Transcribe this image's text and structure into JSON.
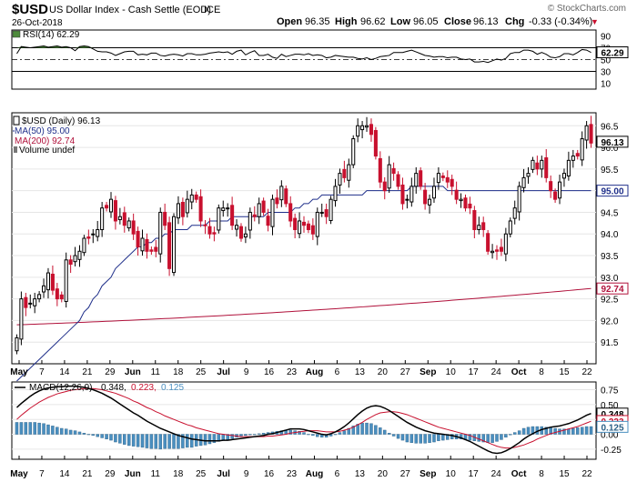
{
  "header": {
    "symbol": "$USD",
    "name": "US Dollar Index - Cash Settle (EOD)",
    "exchange": "ICE",
    "date": "26-Oct-2018",
    "watermark": "© StockCharts.com",
    "quote": {
      "open_label": "Open",
      "open": "96.35",
      "high_label": "High",
      "high": "96.62",
      "low_label": "Low",
      "low": "96.05",
      "close_label": "Close",
      "close": "96.13",
      "chg_label": "Chg",
      "chg": "-0.33 (-0.34%)",
      "chg_arrow": "▼"
    }
  },
  "colors": {
    "up": "#000000",
    "down": "#c8102e",
    "ma50": "#1f2f8a",
    "ma200": "#b0103a",
    "rsi_fill": "#4e8a3c",
    "macd_hist": "#4a8fc0",
    "signal": "#c8102e"
  },
  "chart_data": [
    {
      "type": "line",
      "panel": "rsi",
      "legend": "RSI(14) 62.29",
      "current_label": "62.29",
      "yticks": [
        "90",
        "70",
        "50",
        "30",
        "10"
      ],
      "ylim": [
        0,
        100
      ],
      "overbought": 70,
      "oversold": 30,
      "values": [
        60,
        72,
        71,
        70,
        71,
        72,
        73,
        71,
        72,
        73,
        71,
        72,
        70,
        65,
        72,
        73,
        72,
        68,
        64,
        63,
        63,
        61,
        57,
        60,
        63,
        64,
        64,
        58,
        59,
        58,
        61,
        61,
        57,
        56,
        58,
        59,
        58,
        56,
        60,
        60,
        58,
        58,
        59,
        61,
        62,
        63,
        62,
        63,
        59,
        64,
        66,
        58,
        62,
        65,
        57,
        57,
        59,
        54,
        52,
        59,
        55,
        57,
        59,
        59,
        58,
        60,
        57,
        58,
        57,
        53,
        54,
        57,
        56,
        55,
        54,
        54,
        52,
        51,
        53,
        50,
        52,
        55,
        56,
        57,
        62,
        62,
        62,
        64,
        66,
        63,
        60,
        57,
        56,
        54,
        55,
        55,
        53,
        54,
        54,
        51,
        50,
        51,
        46,
        46,
        47,
        45,
        48,
        51,
        49,
        52,
        60,
        62,
        62,
        66,
        66,
        64,
        59,
        62,
        59,
        54,
        53,
        55,
        60,
        60,
        58,
        62,
        67,
        66,
        62
      ]
    },
    {
      "type": "candlestick",
      "panel": "price",
      "legend": "$USD (Daily) 96.13",
      "ma50_legend": "MA(50) 95.00",
      "ma200_legend": "MA(200) 92.74",
      "volume_legend": "Volume undef",
      "price_label": "96.13",
      "ma50_label": "95.00",
      "ma200_label": "92.74",
      "yticks": [
        "96.5",
        "96.0",
        "95.5",
        "95.0",
        "94.5",
        "94.0",
        "93.5",
        "93.0",
        "92.5",
        "92.0",
        "91.5"
      ],
      "ylim": [
        91.0,
        96.8
      ],
      "x_labels": [
        "May",
        "7",
        "14",
        "21",
        "29",
        "Jun",
        "11",
        "18",
        "25",
        "Jul",
        "9",
        "16",
        "23",
        "Aug",
        "6",
        "13",
        "20",
        "27",
        "Sep",
        "10",
        "17",
        "24",
        "Oct",
        "8",
        "15",
        "22"
      ],
      "close": [
        91.6,
        92.5,
        92.3,
        92.4,
        92.5,
        92.6,
        92.8,
        93.1,
        92.7,
        92.5,
        92.5,
        93.4,
        93.3,
        93.5,
        93.6,
        93.9,
        93.9,
        94.0,
        94.1,
        94.6,
        94.6,
        94.8,
        94.3,
        94.4,
        94.2,
        94.3,
        94.0,
        93.7,
        93.9,
        93.6,
        93.6,
        93.6,
        94.5,
        94.2,
        93.2,
        94.4,
        94.7,
        94.4,
        94.8,
        94.9,
        94.8,
        94.3,
        94.2,
        94.0,
        94.0,
        94.6,
        94.6,
        94.6,
        94.2,
        94.2,
        93.9,
        94.0,
        94.5,
        94.4,
        94.7,
        94.5,
        94.2,
        94.8,
        94.7,
        95.1,
        94.7,
        94.3,
        94.1,
        94.3,
        94.2,
        94.1,
        94.0,
        94.5,
        94.5,
        94.4,
        94.8,
        95.1,
        95.4,
        95.3,
        95.6,
        96.2,
        96.5,
        96.5,
        96.5,
        96.3,
        95.8,
        95.2,
        95.0,
        95.6,
        95.4,
        95.1,
        94.7,
        94.8,
        95.1,
        95.4,
        95.1,
        94.7,
        94.8,
        95.1,
        95.4,
        95.3,
        95.2,
        95.1,
        94.8,
        94.8,
        94.6,
        94.6,
        94.1,
        94.2,
        94.1,
        93.6,
        93.6,
        93.6,
        93.6,
        94.0,
        94.3,
        94.6,
        95.1,
        95.3,
        95.4,
        95.7,
        95.5,
        95.7,
        95.3,
        95.0,
        94.8,
        95.2,
        95.4,
        95.7,
        95.8,
        95.8,
        96.2,
        96.5,
        96.1
      ],
      "ma50": [
        90.6,
        90.7,
        90.8,
        90.9,
        91.0,
        91.1,
        91.2,
        91.3,
        91.4,
        91.5,
        91.6,
        91.7,
        91.8,
        91.9,
        92.0,
        92.2,
        92.3,
        92.5,
        92.6,
        92.8,
        92.9,
        93.0,
        93.2,
        93.3,
        93.4,
        93.5,
        93.6,
        93.7,
        93.7,
        93.8,
        93.8,
        93.9,
        93.9,
        94.0,
        94.0,
        94.1,
        94.1,
        94.1,
        94.1,
        94.2,
        94.2,
        94.2,
        94.2,
        94.3,
        94.3,
        94.3,
        94.3,
        94.3,
        94.4,
        94.4,
        94.4,
        94.4,
        94.4,
        94.4,
        94.4,
        94.4,
        94.5,
        94.5,
        94.5,
        94.5,
        94.5,
        94.5,
        94.6,
        94.6,
        94.7,
        94.7,
        94.8,
        94.8,
        94.9,
        94.9,
        94.9,
        94.9,
        94.9,
        94.9,
        94.9,
        94.9,
        94.9,
        94.9,
        95.0,
        95.0,
        95.0,
        95.0,
        95.0,
        95.0,
        95.0,
        95.0,
        95.0,
        95.0,
        95.1,
        95.1,
        95.1,
        95.1,
        95.1,
        95.1,
        95.1,
        95.1,
        95.0,
        95.0,
        95.0,
        95.0,
        95.0,
        95.0,
        95.0,
        95.0,
        95.0,
        95.0,
        95.0,
        95.0,
        95.0,
        95.0,
        95.0,
        95.0,
        95.0,
        95.0,
        95.0,
        95.0,
        95.0,
        95.0,
        95.0,
        95.0,
        95.0,
        95.0,
        95.0,
        95.0,
        95.0,
        95.0,
        95.0,
        95.0,
        95.0
      ],
      "ma200_range": [
        91.9,
        92.74
      ]
    },
    {
      "type": "macd",
      "panel": "macd",
      "legend_prefix": "MACD(12,26,9)",
      "legend_macd": "0.348,",
      "legend_signal": "0.223,",
      "legend_hist": "0.125",
      "macd_label": "0.348",
      "signal_label": "0.223",
      "hist_label": "0.125",
      "yticks": [
        "0.75",
        "0.50",
        "0.25",
        "0.00",
        "-0.25"
      ],
      "ylim": [
        -0.42,
        0.88
      ],
      "x_labels": [
        "May",
        "7",
        "14",
        "21",
        "29",
        "Jun",
        "11",
        "18",
        "25",
        "Jul",
        "9",
        "16",
        "23",
        "Aug",
        "6",
        "13",
        "20",
        "27",
        "Sep",
        "10",
        "17",
        "24",
        "Oct",
        "8",
        "15",
        "22"
      ],
      "macd": [
        0.45,
        0.52,
        0.58,
        0.64,
        0.69,
        0.73,
        0.76,
        0.78,
        0.79,
        0.8,
        0.8,
        0.81,
        0.81,
        0.81,
        0.8,
        0.79,
        0.77,
        0.75,
        0.72,
        0.69,
        0.65,
        0.61,
        0.56,
        0.51,
        0.46,
        0.41,
        0.36,
        0.32,
        0.27,
        0.22,
        0.18,
        0.14,
        0.1,
        0.07,
        0.04,
        0.01,
        -0.02,
        -0.04,
        -0.06,
        -0.08,
        -0.09,
        -0.1,
        -0.11,
        -0.11,
        -0.11,
        -0.11,
        -0.1,
        -0.1,
        -0.09,
        -0.08,
        -0.07,
        -0.06,
        -0.05,
        -0.04,
        -0.03,
        -0.02,
        0.0,
        0.01,
        0.03,
        0.05,
        0.07,
        0.09,
        0.09,
        0.09,
        0.08,
        0.06,
        0.04,
        0.02,
        0.0,
        -0.01,
        0.01,
        0.04,
        0.08,
        0.13,
        0.19,
        0.26,
        0.33,
        0.39,
        0.44,
        0.47,
        0.48,
        0.47,
        0.44,
        0.4,
        0.35,
        0.3,
        0.25,
        0.2,
        0.16,
        0.12,
        0.09,
        0.06,
        0.04,
        0.02,
        0.01,
        0.0,
        -0.01,
        -0.02,
        -0.04,
        -0.06,
        -0.09,
        -0.12,
        -0.16,
        -0.2,
        -0.24,
        -0.28,
        -0.31,
        -0.32,
        -0.31,
        -0.28,
        -0.24,
        -0.19,
        -0.14,
        -0.08,
        -0.03,
        0.01,
        0.05,
        0.08,
        0.1,
        0.12,
        0.13,
        0.14,
        0.16,
        0.18,
        0.21,
        0.24,
        0.28,
        0.32,
        0.35
      ],
      "signal": [
        0.25,
        0.32,
        0.38,
        0.44,
        0.49,
        0.54,
        0.58,
        0.62,
        0.65,
        0.68,
        0.7,
        0.72,
        0.74,
        0.75,
        0.76,
        0.77,
        0.77,
        0.77,
        0.76,
        0.75,
        0.73,
        0.71,
        0.69,
        0.66,
        0.63,
        0.6,
        0.56,
        0.53,
        0.49,
        0.45,
        0.42,
        0.38,
        0.35,
        0.31,
        0.28,
        0.25,
        0.22,
        0.19,
        0.16,
        0.14,
        0.11,
        0.09,
        0.07,
        0.05,
        0.03,
        0.01,
        0.0,
        -0.01,
        -0.02,
        -0.03,
        -0.04,
        -0.04,
        -0.04,
        -0.04,
        -0.04,
        -0.04,
        -0.03,
        -0.03,
        -0.02,
        -0.01,
        0.0,
        0.02,
        0.03,
        0.04,
        0.05,
        0.06,
        0.06,
        0.06,
        0.05,
        0.04,
        0.04,
        0.04,
        0.05,
        0.07,
        0.09,
        0.12,
        0.16,
        0.2,
        0.25,
        0.29,
        0.33,
        0.36,
        0.37,
        0.38,
        0.38,
        0.37,
        0.35,
        0.33,
        0.3,
        0.27,
        0.24,
        0.21,
        0.18,
        0.15,
        0.12,
        0.1,
        0.08,
        0.06,
        0.04,
        0.02,
        0.0,
        -0.02,
        -0.05,
        -0.08,
        -0.11,
        -0.14,
        -0.17,
        -0.2,
        -0.22,
        -0.23,
        -0.23,
        -0.22,
        -0.2,
        -0.18,
        -0.15,
        -0.12,
        -0.08,
        -0.05,
        -0.02,
        0.01,
        0.03,
        0.05,
        0.07,
        0.09,
        0.11,
        0.13,
        0.16,
        0.19,
        0.22
      ]
    }
  ]
}
